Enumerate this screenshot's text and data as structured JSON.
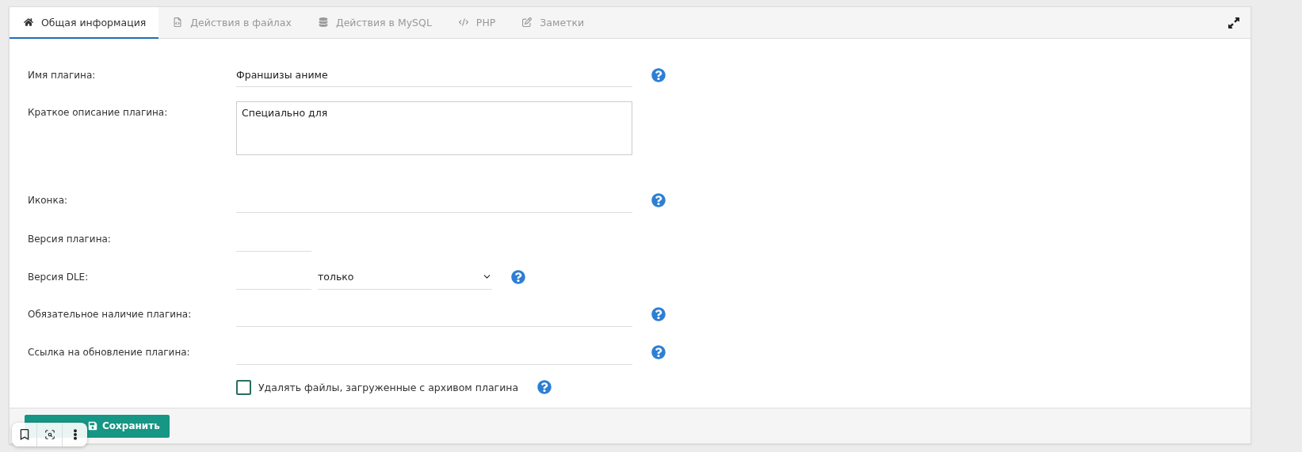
{
  "tabs": [
    {
      "label": "Общая информация",
      "selected": true
    },
    {
      "label": "Действия в файлах",
      "selected": false
    },
    {
      "label": "Действия в MySQL",
      "selected": false
    },
    {
      "label": "PHP",
      "selected": false
    },
    {
      "label": "Заметки",
      "selected": false
    }
  ],
  "form": [
    {
      "kind": "text",
      "label": "Имя плагина:",
      "value": "Франшизы аниме",
      "help": true
    },
    {
      "kind": "textarea",
      "label": "Краткое описание плагина:",
      "value": "Специально для",
      "help": false
    },
    {
      "kind": "text",
      "label": "Иконка:",
      "help": true
    },
    {
      "kind": "short",
      "label": "Версия плагина:",
      "help": false
    },
    {
      "kind": "version-select",
      "label": "Версия DLE:",
      "select": "только",
      "help": true
    },
    {
      "kind": "text",
      "label": "Обязательное наличие плагина:",
      "help": true
    },
    {
      "kind": "text",
      "label": "Ссылка на обновление плагина:",
      "help": true
    },
    {
      "kind": "checkbox",
      "label": "Удалять файлы, загруженные с архивом плагина",
      "checked": false,
      "help": true
    }
  ],
  "save_button": "Сохранить"
}
